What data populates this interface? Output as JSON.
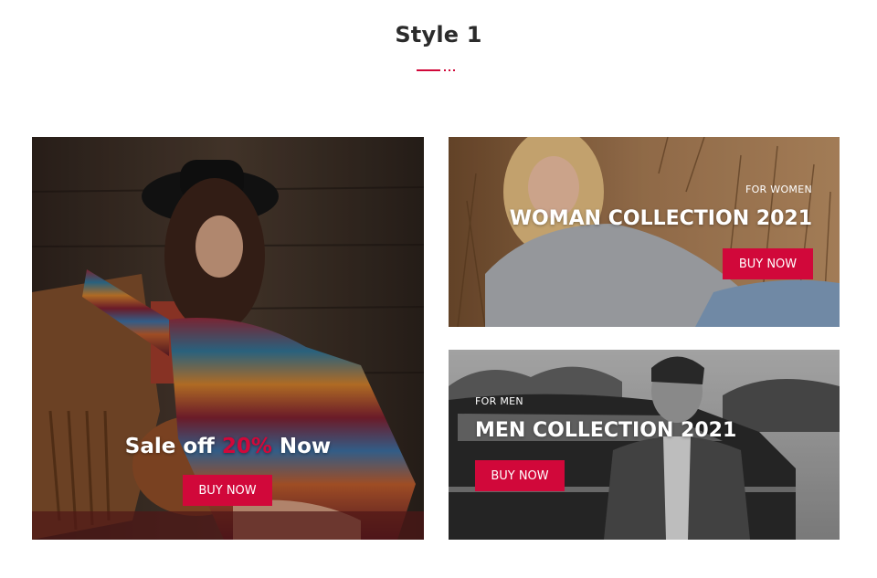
{
  "section": {
    "title": "Style 1"
  },
  "colors": {
    "accent": "#d1083a",
    "heading": "#2b2b2b",
    "button_text": "#ffffff"
  },
  "banners": {
    "sale": {
      "prefix": "Sale off ",
      "highlight": "20%",
      "suffix": " Now",
      "button_label": "BUY NOW"
    },
    "women": {
      "eyebrow": "FOR WOMEN",
      "heading": "WOMAN COLLECTION 2021",
      "button_label": "BUY NOW"
    },
    "men": {
      "eyebrow": "FOR MEN",
      "heading": "MEN COLLECTION 2021",
      "button_label": "BUY NOW"
    }
  }
}
